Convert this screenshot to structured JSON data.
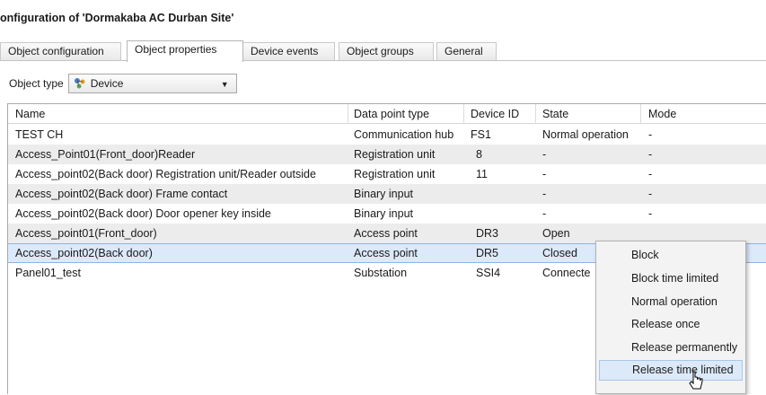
{
  "window": {
    "title": "onfiguration of 'Dormakaba AC Durban Site'"
  },
  "tabs": [
    {
      "label": "Object configuration",
      "active": false
    },
    {
      "label": "Object properties",
      "active": true
    },
    {
      "label": "Device events",
      "active": false
    },
    {
      "label": "Object groups",
      "active": false
    },
    {
      "label": "General",
      "active": false
    }
  ],
  "object_type": {
    "label": "Object type",
    "selected": "Device",
    "icon": "device-icon"
  },
  "grid": {
    "columns": [
      "Name",
      "Data point type",
      "Device ID",
      "State",
      "Mode"
    ],
    "rows": [
      {
        "name": "TEST CH",
        "type": "Communication hub",
        "device_id": "FS1",
        "state": "Normal operation",
        "mode": "-"
      },
      {
        "name": "Access_Point01(Front_door)Reader",
        "type": "Registration unit",
        "device_id": "8",
        "state": "-",
        "mode": "-"
      },
      {
        "name": "Access_point02(Back door) Registration unit/Reader outside",
        "type": "Registration unit",
        "device_id": "11",
        "state": "-",
        "mode": "-"
      },
      {
        "name": "Access_point02(Back door) Frame contact",
        "type": "Binary input",
        "device_id": "",
        "state": "-",
        "mode": "-"
      },
      {
        "name": "Access_point02(Back door) Door opener key inside",
        "type": "Binary input",
        "device_id": "",
        "state": "-",
        "mode": "-"
      },
      {
        "name": "Access_point01(Front_door)",
        "type": "Access point",
        "device_id": "DR3",
        "state": "Open",
        "mode": ""
      },
      {
        "name": "Access_point02(Back door)",
        "type": "Access point",
        "device_id": "DR5",
        "state": "Closed",
        "mode": ""
      },
      {
        "name": "Panel01_test",
        "type": "Substation",
        "device_id": "SSI4",
        "state": "Connecte",
        "mode": ""
      }
    ]
  },
  "context_menu": {
    "items": [
      {
        "label": "Block"
      },
      {
        "label": "Block time limited"
      },
      {
        "label": "Normal operation"
      },
      {
        "label": "Release once"
      },
      {
        "label": "Release permanently"
      },
      {
        "label": "Release time limited",
        "hovered": true
      }
    ]
  },
  "colors": {
    "selection": "#dbe9fb",
    "alt_row": "#ececec",
    "menu_hover": "#dce9f8"
  }
}
